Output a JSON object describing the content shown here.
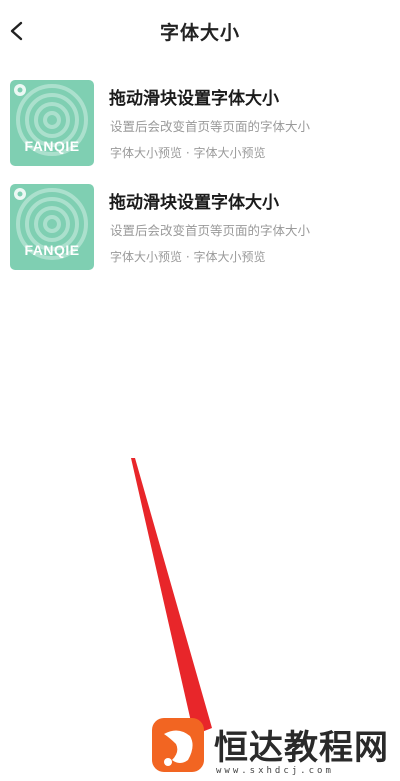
{
  "header": {
    "title": "字体大小",
    "back_icon": "chevron-left-icon"
  },
  "books": [
    {
      "cover_text": "FANQIE",
      "title": "拖动滑块设置字体大小",
      "description": "设置后会改变首页等页面的字体大小",
      "meta": "字体大小预览 · 字体大小预览"
    },
    {
      "cover_text": "FANQIE",
      "title": "拖动滑块设置字体大小",
      "description": "设置后会改变首页等页面的字体大小",
      "meta": "字体大小预览 · 字体大小预览"
    }
  ],
  "watermark": {
    "name": "恒达教程网",
    "url": "www.sxhdcj.com"
  },
  "colors": {
    "cover_bg": "#7fcfb2",
    "arrow": "#e8262a",
    "logo": "#f26522"
  }
}
